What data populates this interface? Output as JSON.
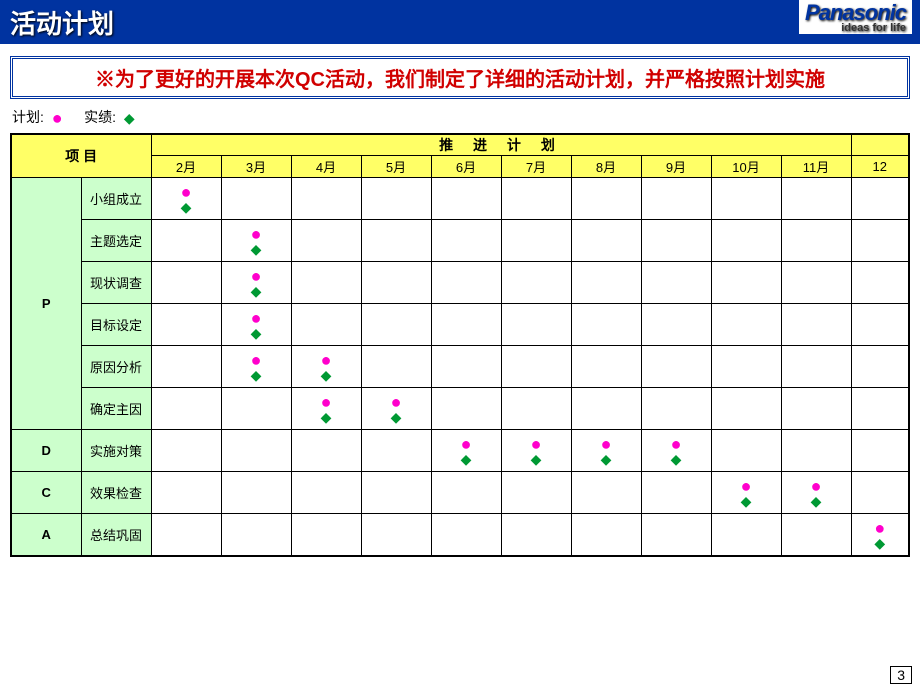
{
  "title": "活动计划",
  "brand": "Panasonic",
  "brand_tag": "ideas for life",
  "banner": "※为了更好的开展本次QC活动，我们制定了详细的活动计划，并严格按照计划实施",
  "legend": {
    "plan_label": "计划:",
    "actual_label": "实绩:"
  },
  "header": {
    "project": "项 目",
    "push": "推 进 计 划"
  },
  "page_number": "3",
  "chart_data": {
    "type": "table",
    "title": "推进计划",
    "months": [
      "2月",
      "3月",
      "4月",
      "5月",
      "6月",
      "7月",
      "8月",
      "9月",
      "10月",
      "11月",
      "12"
    ],
    "phases": [
      {
        "code": "P",
        "tasks": [
          {
            "name": "小组成立",
            "plan": [
              1,
              0,
              0,
              0,
              0,
              0,
              0,
              0,
              0,
              0,
              0
            ],
            "actual": [
              1,
              0,
              0,
              0,
              0,
              0,
              0,
              0,
              0,
              0,
              0
            ]
          },
          {
            "name": "主题选定",
            "plan": [
              0,
              1,
              0,
              0,
              0,
              0,
              0,
              0,
              0,
              0,
              0
            ],
            "actual": [
              0,
              1,
              0,
              0,
              0,
              0,
              0,
              0,
              0,
              0,
              0
            ]
          },
          {
            "name": "现状调查",
            "plan": [
              0,
              1,
              0,
              0,
              0,
              0,
              0,
              0,
              0,
              0,
              0
            ],
            "actual": [
              0,
              1,
              0,
              0,
              0,
              0,
              0,
              0,
              0,
              0,
              0
            ]
          },
          {
            "name": "目标设定",
            "plan": [
              0,
              1,
              0,
              0,
              0,
              0,
              0,
              0,
              0,
              0,
              0
            ],
            "actual": [
              0,
              1,
              0,
              0,
              0,
              0,
              0,
              0,
              0,
              0,
              0
            ]
          },
          {
            "name": "原因分析",
            "plan": [
              0,
              1,
              1,
              0,
              0,
              0,
              0,
              0,
              0,
              0,
              0
            ],
            "actual": [
              0,
              1,
              1,
              0,
              0,
              0,
              0,
              0,
              0,
              0,
              0
            ]
          },
          {
            "name": "确定主因",
            "plan": [
              0,
              0,
              1,
              1,
              0,
              0,
              0,
              0,
              0,
              0,
              0
            ],
            "actual": [
              0,
              0,
              1,
              1,
              0,
              0,
              0,
              0,
              0,
              0,
              0
            ]
          }
        ]
      },
      {
        "code": "D",
        "tasks": [
          {
            "name": "实施对策",
            "plan": [
              0,
              0,
              0,
              0,
              1,
              1,
              1,
              1,
              0,
              0,
              0
            ],
            "actual": [
              0,
              0,
              0,
              0,
              1,
              1,
              1,
              1,
              0,
              0,
              0
            ]
          }
        ]
      },
      {
        "code": "C",
        "tasks": [
          {
            "name": "效果检查",
            "plan": [
              0,
              0,
              0,
              0,
              0,
              0,
              0,
              0,
              1,
              1,
              0
            ],
            "actual": [
              0,
              0,
              0,
              0,
              0,
              0,
              0,
              0,
              1,
              1,
              0
            ]
          }
        ]
      },
      {
        "code": "A",
        "tasks": [
          {
            "name": "总结巩固",
            "plan": [
              0,
              0,
              0,
              0,
              0,
              0,
              0,
              0,
              0,
              0,
              1
            ],
            "actual": [
              0,
              0,
              0,
              0,
              0,
              0,
              0,
              0,
              0,
              0,
              1
            ]
          }
        ]
      }
    ]
  }
}
